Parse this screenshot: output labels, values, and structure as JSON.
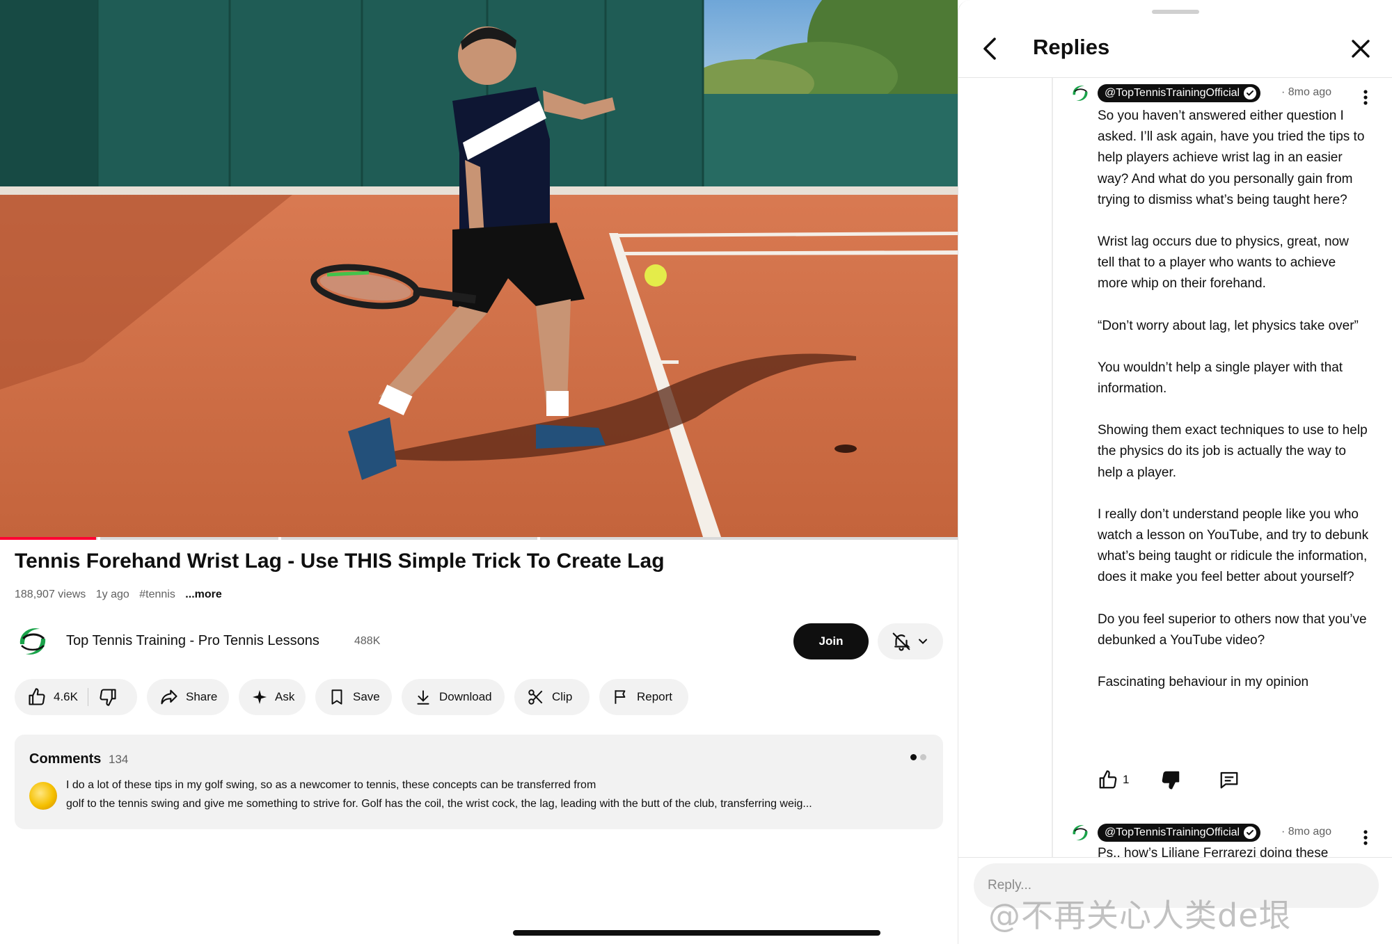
{
  "video": {
    "title": "Tennis Forehand Wrist Lag - Use THIS Simple Trick To Create Lag",
    "views": "188,907 views",
    "age": "1y ago",
    "hashtag": "#tennis",
    "more_label": "...more",
    "progress": 0.1
  },
  "channel": {
    "name": "Top Tennis Training - Pro Tennis Lessons",
    "subscribers": "488K",
    "join_label": "Join"
  },
  "actions": {
    "likes": "4.6K",
    "share": "Share",
    "ask": "Ask",
    "save": "Save",
    "download": "Download",
    "clip": "Clip",
    "report": "Report"
  },
  "comments": {
    "title": "Comments",
    "count": "134",
    "preview_line1": "I do a lot of these tips in my golf swing, so as a newcomer to tennis, these concepts can be transferred from",
    "preview_line2": "golf to the tennis swing and give me something to strive for. Golf has the coil, the wrist cock, the lag, leading with the butt of the club, transferring weig..."
  },
  "replies_panel": {
    "title": "Replies",
    "reply": {
      "author": "@TopTennisTrainingOfficial",
      "time": "· 8mo ago",
      "paragraphs": [
        "So you haven’t answered either question I asked. I’ll ask again, have you tried the tips to help players achieve wrist lag in an easier way? And what do you personally gain from trying to dismiss what’s being taught here?",
        "Wrist lag occurs due to physics, great, now tell that to a player who wants to achieve more whip on their forehand.",
        "“Don’t worry about lag, let physics take over”",
        "You wouldn’t help a single player with that information.",
        "Showing them exact techniques to use to help the physics do its job is actually the way to help a player.",
        "I really don’t understand people like you who watch a lesson on YouTube, and try to debunk what’s being taught or ridicule the information, does it make you feel better about yourself?",
        "Do you feel superior to others now that you’ve debunked a YouTube video?",
        "Fascinating behaviour in my opinion"
      ],
      "like_count": "1"
    },
    "next_reply": {
      "author": "@TopTennisTrainingOfficial",
      "time": "· 8mo ago",
      "preview": "Ps.. how’s Liliane Ferrarezi doing these"
    },
    "reply_placeholder": "Reply..."
  },
  "watermark": "@不再关心人类de垠",
  "colors": {
    "accent_red": "#ff0033",
    "text_primary": "#0f0f0f",
    "text_secondary": "#606060",
    "chip_bg": "#f2f2f2",
    "channel_green": "#1aa34a"
  },
  "icons": [
    "like-icon",
    "dislike-icon",
    "share-icon",
    "sparkle-icon",
    "bookmark-icon",
    "download-icon",
    "scissors-icon",
    "flag-icon",
    "bell-off-icon",
    "chevron-down-icon",
    "back-arrow-icon",
    "close-icon",
    "verified-check-icon",
    "more-vert-icon",
    "comment-icon"
  ]
}
